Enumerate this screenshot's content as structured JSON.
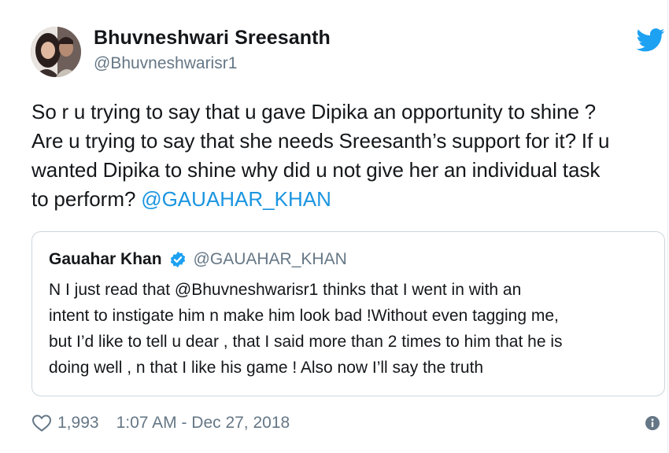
{
  "author": {
    "display_name": "Bhuvneshwari Sreesanth",
    "handle": "@Bhuvneshwarisr1",
    "avatar_icon": "profile-photo-couple"
  },
  "tweet": {
    "lines": [
      "So r u trying to say that u gave Dipika an opportunity to shine ?",
      "Are u trying to say that she needs Sreesanth’s support for it? If u",
      "wanted Dipika to shine why did u not give her an individual task",
      "to perform?"
    ],
    "mention": "@GAUAHAR_KHAN"
  },
  "quoted_tweet": {
    "display_name": "Gauahar Khan",
    "handle": "@GAUAHAR_KHAN",
    "verified_icon": "verified-badge-icon",
    "lines": [
      "N I just read that @Bhuvneshwarisr1 thinks that I went in with an",
      "intent to instigate him n make him look bad !Without even tagging me,",
      "but I’d like to tell u dear , that I said more than 2 times to him that he is",
      "doing well , n that I like his game ! Also now I’ll say the truth"
    ]
  },
  "footer": {
    "likes": "1,993",
    "timestamp": "1:07 AM - Dec 27, 2018"
  },
  "icons": {
    "brand": "twitter-bird-icon",
    "like": "heart-icon",
    "info": "info-icon"
  },
  "colors": {
    "brand_blue": "#1da1f2",
    "mention_blue": "#1b95e0",
    "text": "#14171a",
    "secondary_text": "#657786",
    "border": "#ccd6dd"
  }
}
